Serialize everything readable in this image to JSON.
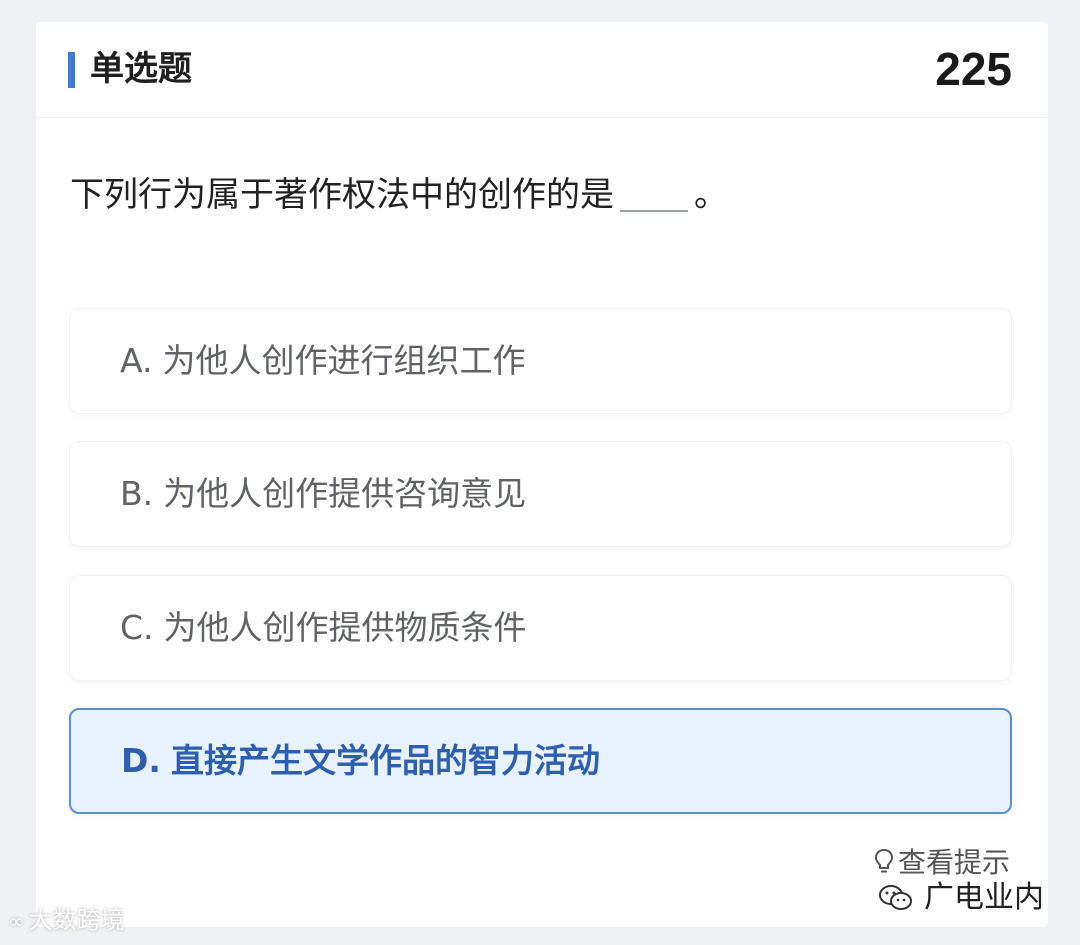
{
  "header": {
    "question_type": "单选题",
    "question_number": "225"
  },
  "question": {
    "text_before_blank": "下列行为属于著作权法中的创作的是",
    "text_after_blank": "。"
  },
  "options": [
    {
      "letter": "A.",
      "text": "为他人创作进行组织工作",
      "selected": false
    },
    {
      "letter": "B.",
      "text": "为他人创作提供咨询意见",
      "selected": false
    },
    {
      "letter": "C.",
      "text": "为他人创作提供物质条件",
      "selected": false
    },
    {
      "letter": "D.",
      "text": "直接产生文学作品的智力活动",
      "selected": true
    }
  ],
  "hint": {
    "icon": "lightbulb-icon",
    "label": "查看提示"
  },
  "watermarks": {
    "left": "大数跨境",
    "right": "广电业内",
    "right_icon": "wechat-icon"
  },
  "colors": {
    "accent": "#3f7bd8",
    "selected_bg": "#e8f1fe",
    "selected_border": "#5d8fd6",
    "selected_text": "#2c5fb0"
  }
}
